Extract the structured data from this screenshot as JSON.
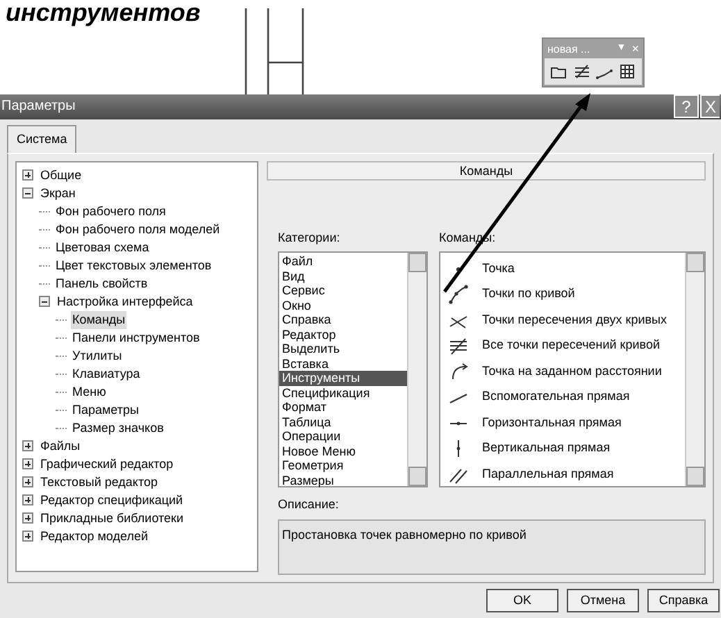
{
  "heading": "инструментов",
  "toolbar": {
    "title": "новая ...",
    "menu_glyph": "▼",
    "close_glyph": "×"
  },
  "window": {
    "title": "Параметры",
    "help_glyph": "?",
    "close_glyph": "X"
  },
  "tabs": [
    {
      "label": "Система",
      "selected": true
    }
  ],
  "tree": [
    {
      "label": "Общие",
      "expanded": false,
      "selected": false
    },
    {
      "label": "Экран",
      "expanded": true,
      "selected": false,
      "children": [
        {
          "label": "Фон рабочего поля",
          "selected": false
        },
        {
          "label": "Фон рабочего поля моделей",
          "selected": false
        },
        {
          "label": "Цветовая схема",
          "selected": false
        },
        {
          "label": "Цвет текстовых элементов",
          "selected": false
        },
        {
          "label": "Панель свойств",
          "selected": false
        },
        {
          "label": "Настройка интерфейса",
          "expanded": true,
          "selected": false,
          "children": [
            {
              "label": "Команды",
              "selected": true
            },
            {
              "label": "Панели инструментов",
              "selected": false
            },
            {
              "label": "Утилиты",
              "selected": false
            },
            {
              "label": "Клавиатура",
              "selected": false
            },
            {
              "label": "Меню",
              "selected": false
            },
            {
              "label": "Параметры",
              "selected": false
            },
            {
              "label": "Размер значков",
              "selected": false
            }
          ]
        }
      ]
    },
    {
      "label": "Файлы",
      "expanded": false,
      "selected": false
    },
    {
      "label": "Графический редактор",
      "expanded": false,
      "selected": false
    },
    {
      "label": "Текстовый редактор",
      "expanded": false,
      "selected": false
    },
    {
      "label": "Редактор спецификаций",
      "expanded": false,
      "selected": false
    },
    {
      "label": "Прикладные библиотеки",
      "expanded": false,
      "selected": false
    },
    {
      "label": "Редактор моделей",
      "expanded": false,
      "selected": false
    }
  ],
  "section_title": "Команды",
  "categories": {
    "label": "Категории:",
    "items": [
      {
        "label": "Файл",
        "selected": false
      },
      {
        "label": "Вид",
        "selected": false
      },
      {
        "label": "Сервис",
        "selected": false
      },
      {
        "label": "Окно",
        "selected": false
      },
      {
        "label": "Справка",
        "selected": false
      },
      {
        "label": "Редактор",
        "selected": false
      },
      {
        "label": "Выделить",
        "selected": false
      },
      {
        "label": "Вставка",
        "selected": false
      },
      {
        "label": "Инструменты",
        "selected": true
      },
      {
        "label": "Спецификация",
        "selected": false
      },
      {
        "label": "Формат",
        "selected": false
      },
      {
        "label": "Таблица",
        "selected": false
      },
      {
        "label": "Операции",
        "selected": false
      },
      {
        "label": "Новое Меню",
        "selected": false
      },
      {
        "label": "Геометрия",
        "selected": false
      },
      {
        "label": "Размеры",
        "selected": false
      }
    ]
  },
  "commands": {
    "label": "Команды:",
    "items": [
      {
        "label": "Точка",
        "kind": "point"
      },
      {
        "label": "Точки по кривой",
        "kind": "curvepoints"
      },
      {
        "label": "Точки пересечения двух кривых",
        "kind": "intersect"
      },
      {
        "label": "Все точки пересечений кривой",
        "kind": "allintersect"
      },
      {
        "label": "Точка на заданном расстоянии",
        "kind": "distance"
      },
      {
        "label": "Вспомогательная прямая",
        "kind": "auxline"
      },
      {
        "label": "Горизонтальная прямая",
        "kind": "hline"
      },
      {
        "label": "Вертикальная прямая",
        "kind": "vline"
      },
      {
        "label": "Параллельная прямая",
        "kind": "parallel"
      }
    ]
  },
  "description": {
    "label": "Описание:",
    "text": "Простановка точек равномерно по кривой"
  },
  "buttons": [
    "OK",
    "Отмена",
    "Справка"
  ]
}
